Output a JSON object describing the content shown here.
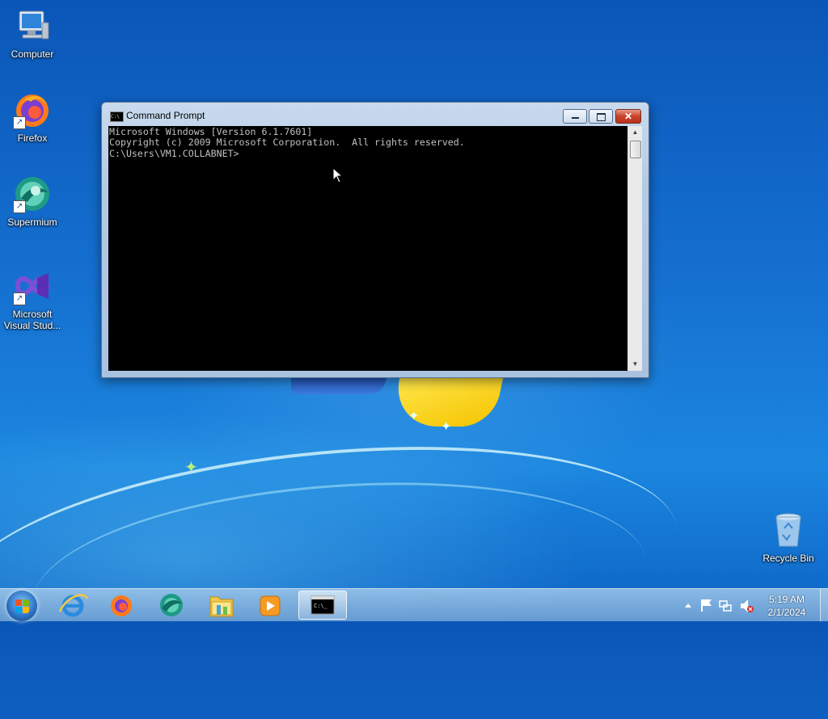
{
  "desktop": {
    "icons": [
      {
        "label": "Computer"
      },
      {
        "label": "Firefox"
      },
      {
        "label": "Supermium"
      },
      {
        "label": "Microsoft Visual Stud..."
      },
      {
        "label": "Recycle Bin"
      }
    ]
  },
  "window": {
    "title": "Command Prompt",
    "console_lines": [
      "Microsoft Windows [Version 6.1.7601]",
      "Copyright (c) 2009 Microsoft Corporation.  All rights reserved.",
      "",
      "C:\\Users\\VM1.COLLABNET>"
    ]
  },
  "taskbar": {
    "pinned": [
      "internet-explorer-icon",
      "firefox-icon",
      "supermium-icon",
      "file-explorer-icon",
      "media-player-icon",
      "command-prompt-icon"
    ],
    "active": "command-prompt-icon",
    "clock": {
      "time": "5:19 AM",
      "date": "2/1/2024"
    }
  },
  "colors": {
    "console_bg": "#000000",
    "console_fg": "#c0c0c0",
    "close_button": "#c7432b"
  }
}
